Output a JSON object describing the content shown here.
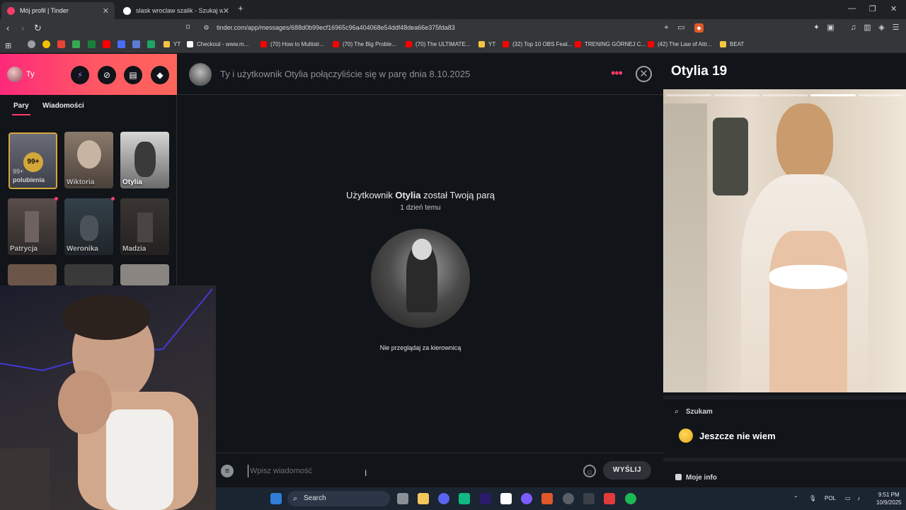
{
  "browser": {
    "tabs": [
      {
        "title": "Mój profil | Tinder",
        "close": "✕"
      },
      {
        "title": "slask wroclaw szalik - Szukaj w Googl",
        "close": "✕"
      }
    ],
    "new_tab": "+",
    "window_controls": {
      "minimize": "—",
      "restore": "❐",
      "close": "✕"
    },
    "url": "tinder.com/app/messages/688d0b99ecf16965c96a404068e54ddf48dea66e375fda83",
    "bookmarks": [
      {
        "label": "YT",
        "color": "#f4c542"
      },
      {
        "label": "Checkout - www.m...",
        "color": "#ffffff"
      },
      {
        "label": "(70) How to Multistr...",
        "color": "#ff0000"
      },
      {
        "label": "(70) The Big Proble...",
        "color": "#ff0000"
      },
      {
        "label": "(70) The ULTIMATE...",
        "color": "#ff0000"
      },
      {
        "label": "YT",
        "color": "#f4c542"
      },
      {
        "label": "(32) Top 10 OBS Feat...",
        "color": "#ff0000"
      },
      {
        "label": "TRENING GÓRNEJ C...",
        "color": "#ff0000"
      },
      {
        "label": "(42) The Law of Attr...",
        "color": "#ff0000"
      },
      {
        "label": "BEAT",
        "color": "#f4c542"
      }
    ]
  },
  "tinder": {
    "user_label": "Ty",
    "left_tabs": {
      "matches": "Pary",
      "messages": "Wiadomości"
    },
    "likes_tile": {
      "badge": "99+",
      "count": "99+",
      "label": "polubienia"
    },
    "matches": [
      {
        "name": "Wiktoria"
      },
      {
        "name": "Otylia"
      },
      {
        "name": "Patrycja"
      },
      {
        "name": "Weronika"
      },
      {
        "name": "Madzia"
      }
    ],
    "chat": {
      "header_text": "Ty i użytkownik Otylia połączyliście się w parę dnia 8.10.2025",
      "more_icon": "•••",
      "close_icon": "✕",
      "match_prefix": "Użytkownik",
      "match_name": "Otylia",
      "match_suffix": "został Twoją parą",
      "match_time": "1 dzień temu",
      "bio": "Nie przeglądaj za kierownicą",
      "input_placeholder": "Wpisz wiadomość",
      "send_label": "WYŚLIJ"
    },
    "profile": {
      "name": "Otylia 19",
      "looking_for_title": "Szukam",
      "looking_for_value": "Jeszcze nie wiem",
      "info_title": "Moje info"
    }
  },
  "taskbar": {
    "search_label": "Search",
    "language": "POL",
    "time": "9:51 PM",
    "date": "10/9/2025"
  }
}
